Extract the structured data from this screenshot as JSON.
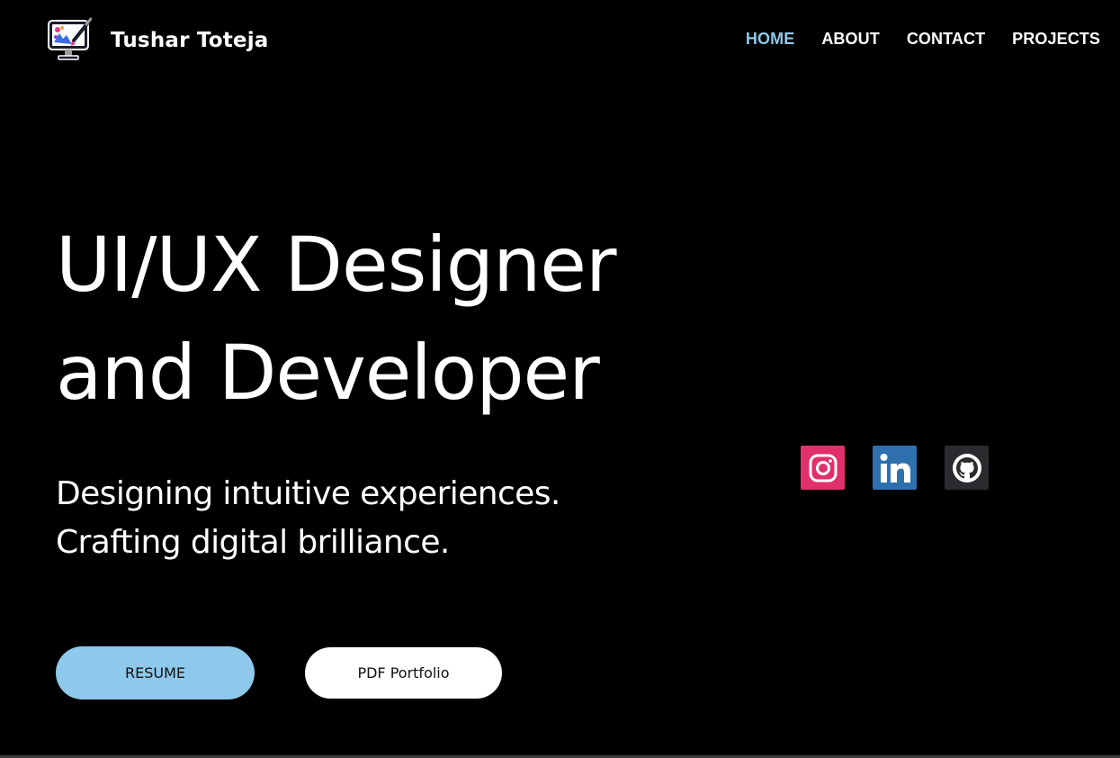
{
  "brand": {
    "name": "Tushar Toteja",
    "logo_icon": "monitor-paintbrush-icon"
  },
  "nav": {
    "items": [
      {
        "label": "HOME",
        "active": true
      },
      {
        "label": "ABOUT",
        "active": false
      },
      {
        "label": "CONTACT",
        "active": false
      },
      {
        "label": "PROJECTS",
        "active": false
      }
    ],
    "active_color": "#8ec8ea"
  },
  "hero": {
    "title_line1": "UI/UX Designer",
    "title_line2": "and Developer",
    "subtitle_line1": "Designing intuitive experiences.",
    "subtitle_line2": "Crafting digital brilliance."
  },
  "social": [
    {
      "icon": "instagram-icon",
      "color": "#e1306c"
    },
    {
      "icon": "linkedin-icon",
      "color": "#2e6fad"
    },
    {
      "icon": "github-icon",
      "color": "#2a2b2e"
    }
  ],
  "buttons": {
    "resume_label": "RESUME",
    "portfolio_label": "PDF Portfolio",
    "resume_color": "#8ec8ea",
    "portfolio_color": "#ffffff"
  },
  "colors": {
    "background": "#000000",
    "text": "#ffffff"
  }
}
